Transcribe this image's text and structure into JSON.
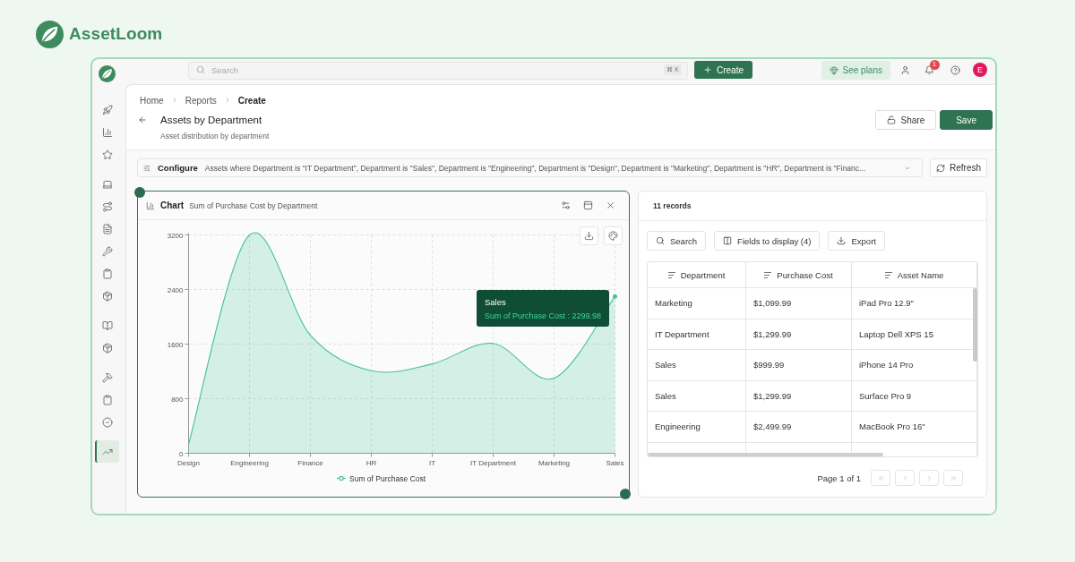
{
  "brand": {
    "name": "AssetLoom"
  },
  "top_bar": {
    "search": {
      "placeholder": "Search",
      "shortcut": "⌘ K"
    },
    "create_label": "Create",
    "plans_label": "See plans",
    "notification_count": "1",
    "avatar_initial": "E"
  },
  "sidebar": {
    "groups": [
      {
        "items": [
          {
            "selected": false
          },
          {
            "selected": false
          },
          {
            "selected": false
          }
        ]
      },
      {
        "items": [
          {
            "selected": false
          },
          {
            "selected": false
          },
          {
            "selected": false
          },
          {
            "selected": false
          },
          {
            "selected": false
          },
          {
            "selected": false
          }
        ]
      },
      {
        "items": [
          {
            "selected": false
          },
          {
            "selected": false
          }
        ]
      },
      {
        "items": [
          {
            "selected": false
          },
          {
            "selected": false
          },
          {
            "selected": false
          }
        ]
      },
      {
        "items": [
          {
            "selected": true
          }
        ]
      }
    ]
  },
  "breadcrumbs": [
    {
      "label": "Home",
      "current": false
    },
    {
      "label": "Reports",
      "current": false
    },
    {
      "label": "Create",
      "current": true
    }
  ],
  "header": {
    "title": "Assets by Department",
    "subtitle": "Asset distribution by department",
    "buttons": [
      {
        "kind": "share",
        "label": "Share"
      },
      {
        "kind": "save",
        "label": "Save"
      }
    ]
  },
  "filter_bar": {
    "label": "Configure",
    "summary": "Assets where Department is \"IT Department\", Department is \"Sales\", Department is \"Engineering\", Department is \"Design\", Department is \"Marketing\", Department is \"HR\", Department is \"Financ...",
    "refresh_label": "Refresh"
  },
  "chart_panel": {
    "label": "Chart",
    "chart_data": {
      "type": "area",
      "title": "Sum of Purchase Cost by Department",
      "categories": [
        "Design",
        "Engineering",
        "Finance",
        "HR",
        "IT",
        "IT Department",
        "Marketing",
        "Sales"
      ],
      "series": [
        {
          "name": "Sum of Purchase Cost",
          "color": "#45c39a",
          "values": [
            130,
            3200,
            1730,
            1210,
            1310,
            1610,
            1100,
            2300
          ]
        }
      ],
      "ylim": [
        0,
        3200
      ],
      "yticks": [
        0,
        800,
        1600,
        2400,
        3200
      ],
      "grid": true
    },
    "tooltip": {
      "title": "Sales",
      "text": "Sum of Purchase Cost : 2299.98"
    }
  },
  "records_panel": {
    "count_label": "11 records",
    "tools": [
      {
        "kind": "search",
        "label": "Search"
      },
      {
        "kind": "fields",
        "label": "Fields to display (4)"
      },
      {
        "kind": "export",
        "label": "Export"
      }
    ],
    "table": {
      "columns": [
        "Department",
        "Purchase Cost",
        "Asset Name"
      ],
      "rows": [
        [
          "Marketing",
          "$1,099.99",
          "iPad Pro 12.9\""
        ],
        [
          "IT Department",
          "$1,299.99",
          "Laptop Dell XPS 15"
        ],
        [
          "Sales",
          "$999.99",
          "iPhone 14 Pro"
        ],
        [
          "Sales",
          "$1,299.99",
          "Surface Pro 9"
        ],
        [
          "Engineering",
          "$2,499.99",
          "MacBook Pro 16\""
        ]
      ]
    },
    "pagination": {
      "label": "Page 1 of 1",
      "buttons": [
        {
          "kind": "first",
          "disabled": true
        },
        {
          "kind": "previous",
          "disabled": true
        },
        {
          "kind": "next",
          "disabled": true
        },
        {
          "kind": "last",
          "disabled": true
        }
      ]
    }
  }
}
